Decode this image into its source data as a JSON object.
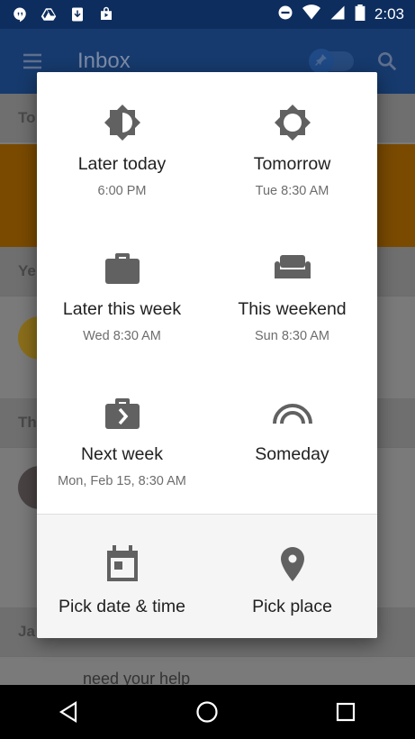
{
  "status_bar": {
    "time": "2:03"
  },
  "app_bar": {
    "title": "Inbox"
  },
  "background": {
    "sections": [
      "To",
      "Ye",
      "Th",
      "Ja"
    ],
    "row_text": "need your help"
  },
  "snooze_options": [
    {
      "label": "Later today",
      "sub": "6:00 PM",
      "icon": "brightness-half-icon"
    },
    {
      "label": "Tomorrow",
      "sub": "Tue 8:30 AM",
      "icon": "brightness-icon"
    },
    {
      "label": "Later this week",
      "sub": "Wed 8:30 AM",
      "icon": "briefcase-icon"
    },
    {
      "label": "This weekend",
      "sub": "Sun 8:30 AM",
      "icon": "couch-icon"
    },
    {
      "label": "Next week",
      "sub": "Mon, Feb 15, 8:30 AM",
      "icon": "briefcase-next-icon"
    },
    {
      "label": "Someday",
      "sub": "",
      "icon": "rainbow-icon"
    }
  ],
  "bottom_options": [
    {
      "label": "Pick date & time",
      "icon": "calendar-icon"
    },
    {
      "label": "Pick place",
      "icon": "location-pin-icon"
    }
  ],
  "colors": {
    "icon": "#616161",
    "text": "#212121",
    "subtext": "#6d6d6d"
  }
}
